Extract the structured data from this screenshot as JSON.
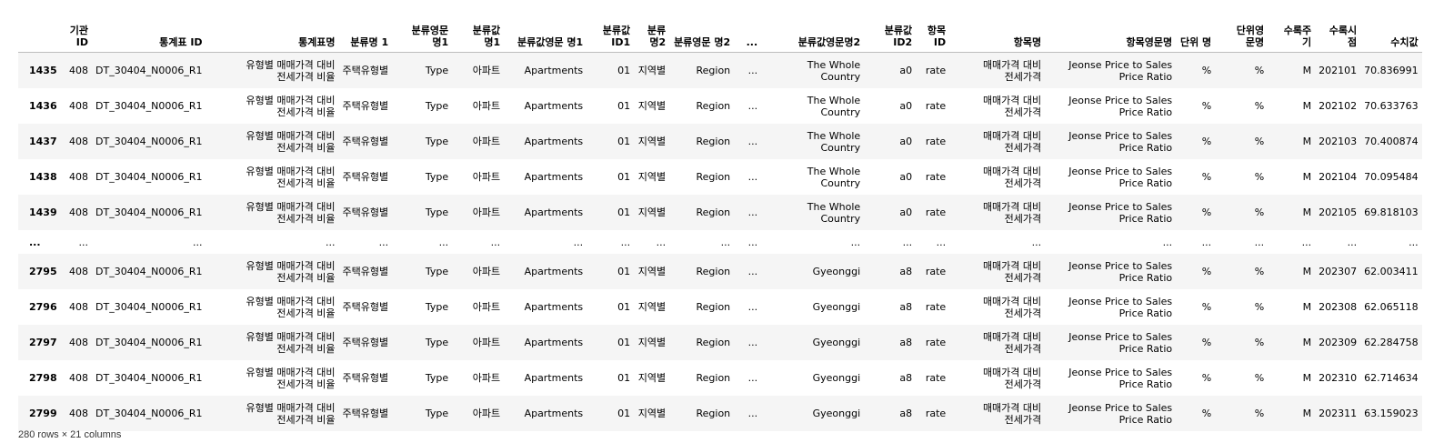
{
  "table": {
    "columns": [
      "",
      "기관 ID",
      "통계표 ID",
      "통계표명",
      "분류명 1",
      "분류영문 명1",
      "분류값 명1",
      "분류값영문 명1",
      "분류값 ID1",
      "분류 명2",
      "분류영문 명2",
      "...",
      "분류값영문명2",
      "분류값 ID2",
      "항목 ID",
      "항목명",
      "항목영문명",
      "단위 명",
      "단위영 문명",
      "수록주 기",
      "수록시 점",
      "수치값"
    ],
    "rows": [
      [
        "1435",
        "408",
        "DT_30404_N0006_R1",
        "유형별 매매가격 대비 전세가격 비율",
        "주택유형별",
        "Type",
        "아파트",
        "Apartments",
        "01",
        "지역별",
        "Region",
        "...",
        "The Whole Country",
        "a0",
        "rate",
        "매매가격 대비 전세가격",
        "Jeonse Price to Sales Price Ratio",
        "%",
        "%",
        "M",
        "202101",
        "70.836991"
      ],
      [
        "1436",
        "408",
        "DT_30404_N0006_R1",
        "유형별 매매가격 대비 전세가격 비율",
        "주택유형별",
        "Type",
        "아파트",
        "Apartments",
        "01",
        "지역별",
        "Region",
        "...",
        "The Whole Country",
        "a0",
        "rate",
        "매매가격 대비 전세가격",
        "Jeonse Price to Sales Price Ratio",
        "%",
        "%",
        "M",
        "202102",
        "70.633763"
      ],
      [
        "1437",
        "408",
        "DT_30404_N0006_R1",
        "유형별 매매가격 대비 전세가격 비율",
        "주택유형별",
        "Type",
        "아파트",
        "Apartments",
        "01",
        "지역별",
        "Region",
        "...",
        "The Whole Country",
        "a0",
        "rate",
        "매매가격 대비 전세가격",
        "Jeonse Price to Sales Price Ratio",
        "%",
        "%",
        "M",
        "202103",
        "70.400874"
      ],
      [
        "1438",
        "408",
        "DT_30404_N0006_R1",
        "유형별 매매가격 대비 전세가격 비율",
        "주택유형별",
        "Type",
        "아파트",
        "Apartments",
        "01",
        "지역별",
        "Region",
        "...",
        "The Whole Country",
        "a0",
        "rate",
        "매매가격 대비 전세가격",
        "Jeonse Price to Sales Price Ratio",
        "%",
        "%",
        "M",
        "202104",
        "70.095484"
      ],
      [
        "1439",
        "408",
        "DT_30404_N0006_R1",
        "유형별 매매가격 대비 전세가격 비율",
        "주택유형별",
        "Type",
        "아파트",
        "Apartments",
        "01",
        "지역별",
        "Region",
        "...",
        "The Whole Country",
        "a0",
        "rate",
        "매매가격 대비 전세가격",
        "Jeonse Price to Sales Price Ratio",
        "%",
        "%",
        "M",
        "202105",
        "69.818103"
      ],
      [
        "...",
        "...",
        "...",
        "...",
        "...",
        "...",
        "...",
        "...",
        "...",
        "...",
        "...",
        "...",
        "...",
        "...",
        "...",
        "...",
        "...",
        "...",
        "...",
        "...",
        "...",
        "..."
      ],
      [
        "2795",
        "408",
        "DT_30404_N0006_R1",
        "유형별 매매가격 대비 전세가격 비율",
        "주택유형별",
        "Type",
        "아파트",
        "Apartments",
        "01",
        "지역별",
        "Region",
        "...",
        "Gyeonggi",
        "a8",
        "rate",
        "매매가격 대비 전세가격",
        "Jeonse Price to Sales Price Ratio",
        "%",
        "%",
        "M",
        "202307",
        "62.003411"
      ],
      [
        "2796",
        "408",
        "DT_30404_N0006_R1",
        "유형별 매매가격 대비 전세가격 비율",
        "주택유형별",
        "Type",
        "아파트",
        "Apartments",
        "01",
        "지역별",
        "Region",
        "...",
        "Gyeonggi",
        "a8",
        "rate",
        "매매가격 대비 전세가격",
        "Jeonse Price to Sales Price Ratio",
        "%",
        "%",
        "M",
        "202308",
        "62.065118"
      ],
      [
        "2797",
        "408",
        "DT_30404_N0006_R1",
        "유형별 매매가격 대비 전세가격 비율",
        "주택유형별",
        "Type",
        "아파트",
        "Apartments",
        "01",
        "지역별",
        "Region",
        "...",
        "Gyeonggi",
        "a8",
        "rate",
        "매매가격 대비 전세가격",
        "Jeonse Price to Sales Price Ratio",
        "%",
        "%",
        "M",
        "202309",
        "62.284758"
      ],
      [
        "2798",
        "408",
        "DT_30404_N0006_R1",
        "유형별 매매가격 대비 전세가격 비율",
        "주택유형별",
        "Type",
        "아파트",
        "Apartments",
        "01",
        "지역별",
        "Region",
        "...",
        "Gyeonggi",
        "a8",
        "rate",
        "매매가격 대비 전세가격",
        "Jeonse Price to Sales Price Ratio",
        "%",
        "%",
        "M",
        "202310",
        "62.714634"
      ],
      [
        "2799",
        "408",
        "DT_30404_N0006_R1",
        "유형별 매매가격 대비 전세가격 비율",
        "주택유형별",
        "Type",
        "아파트",
        "Apartments",
        "01",
        "지역별",
        "Region",
        "...",
        "Gyeonggi",
        "a8",
        "rate",
        "매매가격 대비 전세가격",
        "Jeonse Price to Sales Price Ratio",
        "%",
        "%",
        "M",
        "202311",
        "63.159023"
      ]
    ]
  },
  "footer": {
    "shape": "280 rows × 21 columns"
  }
}
